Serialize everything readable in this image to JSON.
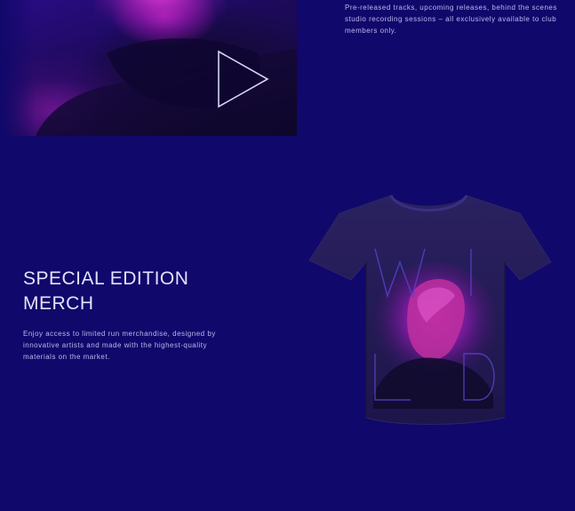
{
  "media": {
    "play_icon": "play-icon",
    "description": "Pre-released tracks, upcoming releases, behind the scenes studio recording sessions – all exclusively available to club members only."
  },
  "merch": {
    "title_line_1": "SPECIAL EDITION",
    "title_line_2": "MERCH",
    "description": "Enjoy access to limited run merchandise, designed by innovative artists and made with the highest-quality materials on the market.",
    "shirt_graphic_letters": [
      "W",
      "I",
      "L",
      "D"
    ]
  },
  "colors": {
    "background": "#10086a",
    "text_primary": "#e4e0ff",
    "text_secondary": "#bfb6f0",
    "accent_magenta": "#d02bc6",
    "shirt": "#221a55"
  }
}
